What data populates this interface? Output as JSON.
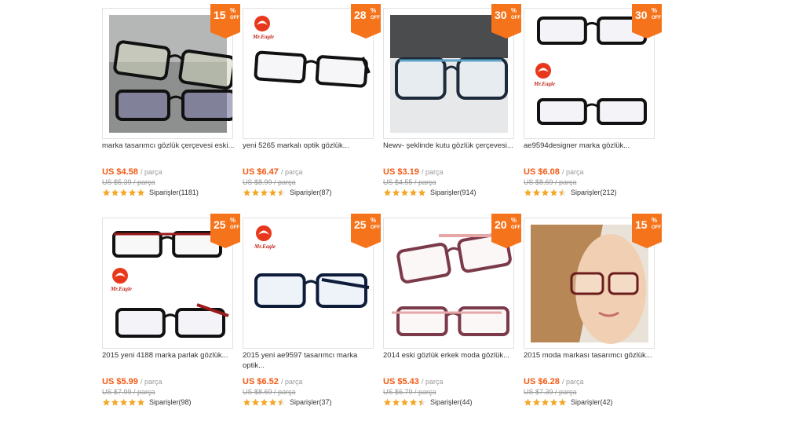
{
  "colors": {
    "accent": "#f35a14",
    "badge": "#f5731b",
    "star": "#f5a623"
  },
  "products": [
    {
      "discount": "15",
      "title": "marka tasarımcı gözlük çerçevesi eski...",
      "price": "US $4.58",
      "unit": "/ parça",
      "old_price": "US $5.39 / parça",
      "rating": 5.0,
      "orders": "Siparişler(1181)",
      "image": "glasses-black-reflection"
    },
    {
      "discount": "28",
      "title": "yeni 5265 markalı optik gözlük...",
      "price": "US $6.47",
      "unit": "/ parça",
      "old_price": "US $8.99 / parça",
      "rating": 4.5,
      "orders": "Siparişler(87)",
      "image": "glasses-black-mr-eagle"
    },
    {
      "discount": "30",
      "title": "Newv- şeklinde kutu gözlük çerçevesi...",
      "price": "US $3.19",
      "unit": "/ parça",
      "old_price": "US $4.55 / parça",
      "rating": 5.0,
      "orders": "Siparişler(914)",
      "image": "glasses-blue-box"
    },
    {
      "discount": "30",
      "title": "ae9594designer marka gözlük...",
      "price": "US $6.08",
      "unit": "/ parça",
      "old_price": "US $8.69 / parça",
      "rating": 4.5,
      "orders": "Siparişler(212)",
      "image": "glasses-two-black"
    },
    {
      "discount": "25",
      "title": "2015 yeni 4188 marka parlak gözlük...",
      "price": "US $5.99",
      "unit": "/ parça",
      "old_price": "US $7.99 / parça",
      "rating": 5.0,
      "orders": "Siparişler(98)",
      "image": "glasses-red-two"
    },
    {
      "discount": "25",
      "title": "2015 yeni ae9597 tasarımcı marka optik...",
      "price": "US $6.52",
      "unit": "/ parça",
      "old_price": "US $8.69 / parça",
      "rating": 4.5,
      "orders": "Siparişler(37)",
      "image": "glasses-blue-mr-eagle"
    },
    {
      "discount": "20",
      "title": "2014 eski gözlük erkek moda gözlük...",
      "price": "US $5.43",
      "unit": "/ parça",
      "old_price": "US $6.79 / parça",
      "rating": 4.5,
      "orders": "Siparişler(44)",
      "image": "glasses-pink-two"
    },
    {
      "discount": "15",
      "title": "2015 moda markası tasarımcı gözlük...",
      "price": "US $6.28",
      "unit": "/ parça",
      "old_price": "US $7.39 / parça",
      "rating": 5.0,
      "orders": "Siparişler(42)",
      "image": "woman-wearing-glasses"
    }
  ],
  "badge": {
    "percent_symbol": "%",
    "off_label": "OFF"
  },
  "brand_logo": "Mr.Eagle"
}
